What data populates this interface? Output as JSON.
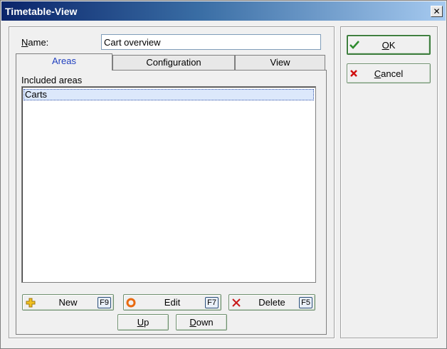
{
  "window": {
    "title": "Timetable-View",
    "close_label": "✕"
  },
  "form": {
    "name_label_accel": "N",
    "name_label_rest": "ame:",
    "name_value": "Cart overview"
  },
  "tabs": [
    {
      "label": "Areas",
      "active": true
    },
    {
      "label": "Configuration",
      "active": false
    },
    {
      "label": "View",
      "active": false
    }
  ],
  "areas": {
    "included_label": "Included areas",
    "items": [
      "Carts"
    ]
  },
  "buttons": {
    "new": {
      "label": "New",
      "key": "F9"
    },
    "edit": {
      "label": "Edit",
      "key": "F7"
    },
    "delete": {
      "label": "Delete",
      "key": "F5"
    },
    "up": {
      "accel": "U",
      "rest": "p"
    },
    "down": {
      "accel": "D",
      "rest": "own"
    },
    "ok": {
      "accel": "O",
      "rest": "K"
    },
    "cancel": {
      "accel": "C",
      "rest": "ancel"
    }
  },
  "colors": {
    "active_tab_text": "#1f3fbf",
    "ok_icon": "#2e8b2e",
    "cancel_icon": "#d01010",
    "new_icon": "#f0c020",
    "edit_icon": "#e86a10",
    "delete_icon": "#c81818"
  }
}
